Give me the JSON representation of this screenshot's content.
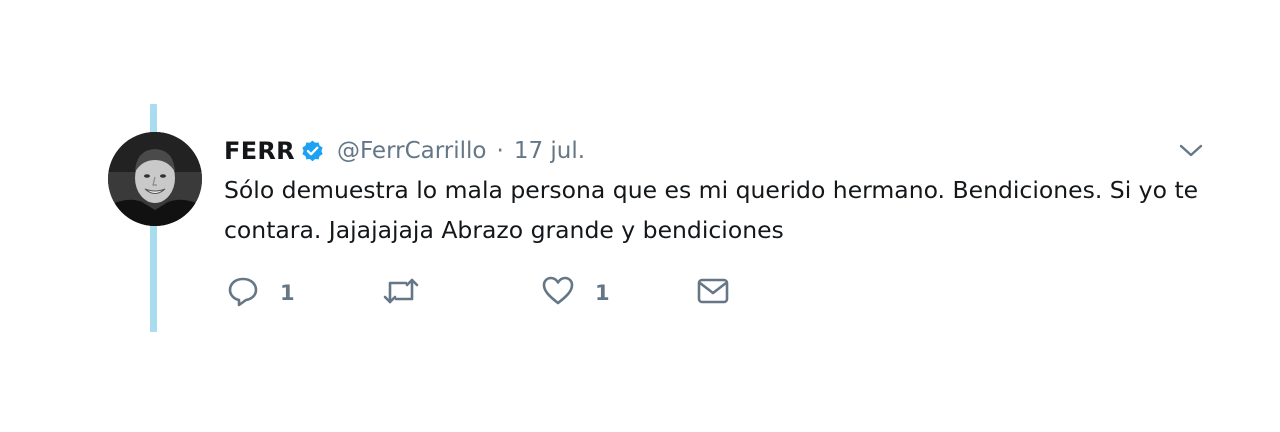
{
  "colors": {
    "thread_line": "#a9dcef",
    "muted": "#657786",
    "verified_badge": "#1da1f2",
    "text": "#14171a"
  },
  "tweet": {
    "author_name": "FERR",
    "verified": true,
    "handle": "@FerrCarrillo",
    "separator": "·",
    "timestamp": "17 jul.",
    "text": "Sólo demuestra lo mala persona que es mi querido hermano. Bendiciones. Si yo te contara. Jajajajaja Abrazo grande y bendiciones"
  },
  "actions": {
    "reply": {
      "icon": "reply-icon",
      "count": "1"
    },
    "retweet": {
      "icon": "retweet-icon",
      "count": ""
    },
    "like": {
      "icon": "heart-icon",
      "count": "1"
    },
    "direct_message": {
      "icon": "envelope-icon"
    }
  },
  "icons": {
    "more_menu": "chevron-down-icon",
    "verified": "verified-badge-icon",
    "avatar": "profile-photo"
  }
}
